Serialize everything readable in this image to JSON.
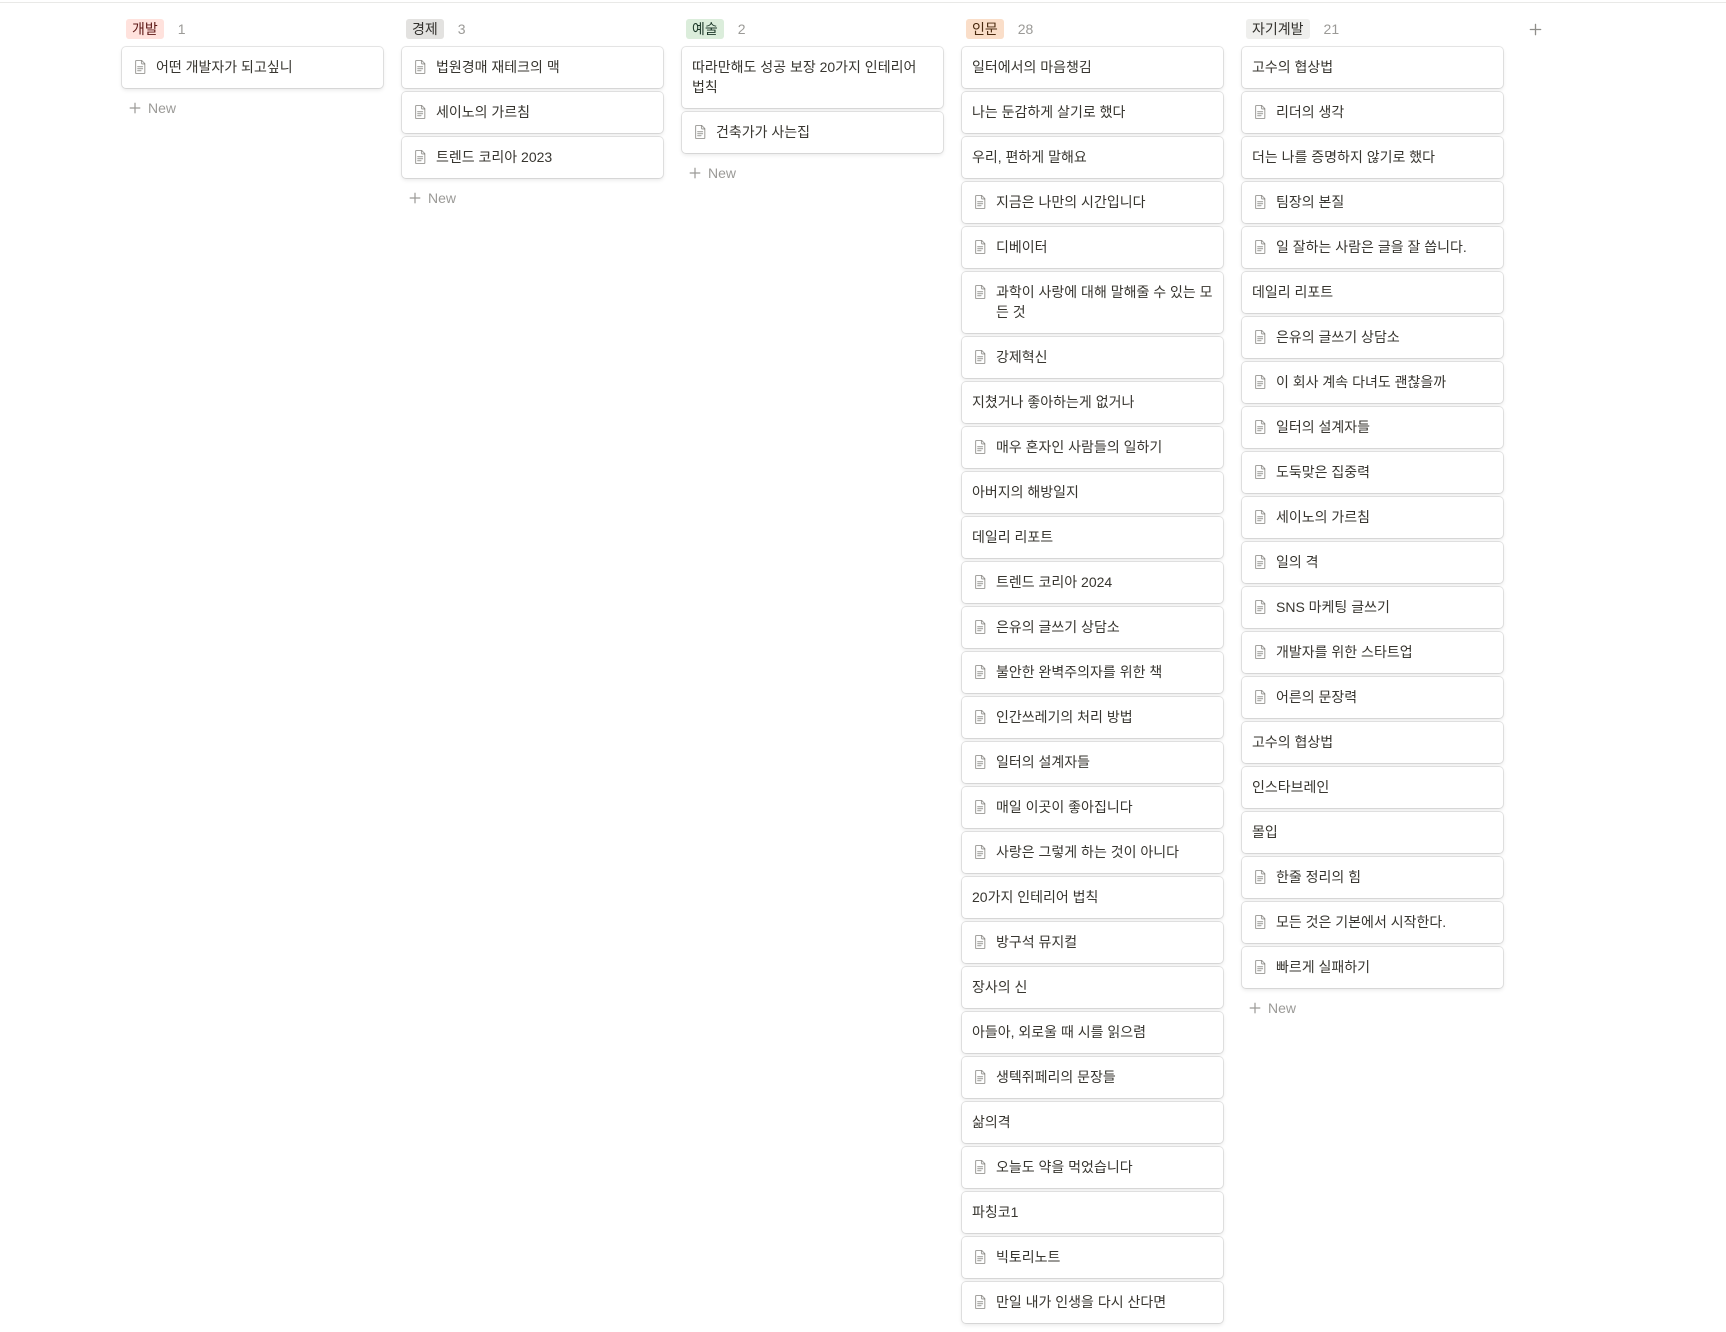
{
  "board": {
    "add_group_icon": "plus-icon",
    "new_label": "New",
    "new_icon": "plus-icon",
    "columns": [
      {
        "tag": "개발",
        "count": 1,
        "tag_bg": "#FFE2DD",
        "tag_fg": "#5D1715",
        "cards": [
          {
            "title": "어떤 개발자가 되고싶니",
            "icon": "page-icon"
          }
        ]
      },
      {
        "tag": "경제",
        "count": 3,
        "tag_bg": "#E3E2E0",
        "tag_fg": "#32302C",
        "cards": [
          {
            "title": "법원경매 재테크의 맥",
            "icon": "page-icon"
          },
          {
            "title": "세이노의 가르침",
            "icon": "page-icon"
          },
          {
            "title": "트렌드 코리아 2023",
            "icon": "page-icon"
          }
        ]
      },
      {
        "tag": "예술",
        "count": 2,
        "tag_bg": "#DBEDDB",
        "tag_fg": "#1C3829",
        "cards": [
          {
            "title": "따라만해도 성공 보장 20가지 인테리어 법칙",
            "icon": null
          },
          {
            "title": "건축가가 사는집",
            "icon": "page-icon"
          }
        ]
      },
      {
        "tag": "인문",
        "count": 28,
        "tag_bg": "#FADEC9",
        "tag_fg": "#49290E",
        "cards": [
          {
            "title": "일터에서의 마음챙김",
            "icon": null
          },
          {
            "title": "나는 둔감하게 살기로 했다",
            "icon": null
          },
          {
            "title": "우리, 편하게 말해요",
            "icon": null
          },
          {
            "title": "지금은 나만의 시간입니다",
            "icon": "page-icon"
          },
          {
            "title": "디베이터",
            "icon": "page-icon"
          },
          {
            "title": "과학이 사랑에 대해 말해줄 수 있는 모든 것",
            "icon": "page-icon"
          },
          {
            "title": "강제혁신",
            "icon": "page-icon"
          },
          {
            "title": "지쳤거나 좋아하는게 없거나",
            "icon": null
          },
          {
            "title": "매우 혼자인 사람들의 일하기",
            "icon": "page-icon"
          },
          {
            "title": "아버지의 해방일지",
            "icon": null
          },
          {
            "title": "데일리 리포트",
            "icon": null
          },
          {
            "title": "트렌드 코리아 2024",
            "icon": "page-icon"
          },
          {
            "title": "은유의 글쓰기 상담소",
            "icon": "page-icon"
          },
          {
            "title": "불안한 완벽주의자를 위한 책",
            "icon": "page-icon"
          },
          {
            "title": "인간쓰레기의 처리 방법",
            "icon": "page-icon"
          },
          {
            "title": "일터의 설계자들",
            "icon": "page-icon"
          },
          {
            "title": "매일 이곳이 좋아집니다",
            "icon": "page-icon"
          },
          {
            "title": "사랑은 그렇게 하는 것이 아니다",
            "icon": "page-icon"
          },
          {
            "title": "20가지 인테리어 법칙",
            "icon": null
          },
          {
            "title": "방구석 뮤지컬",
            "icon": "page-icon"
          },
          {
            "title": "장사의 신",
            "icon": null
          },
          {
            "title": "아들아, 외로울 때 시를 읽으렴",
            "icon": null
          },
          {
            "title": "생텍쥐페리의 문장들",
            "icon": "page-icon"
          },
          {
            "title": "삶의격",
            "icon": null
          },
          {
            "title": "오늘도 약을 먹었습니다",
            "icon": "page-icon"
          },
          {
            "title": "파칭코1",
            "icon": null
          },
          {
            "title": "빅토리노트",
            "icon": "page-icon"
          },
          {
            "title": "만일 내가 인생을 다시 산다면",
            "icon": "page-icon"
          }
        ]
      },
      {
        "tag": "자기계발",
        "count": 21,
        "tag_bg": "#EFEFED",
        "tag_fg": "#32302C",
        "cards": [
          {
            "title": "고수의 협상법",
            "icon": null
          },
          {
            "title": "리더의 생각",
            "icon": "page-icon"
          },
          {
            "title": "더는 나를 증명하지 않기로 했다",
            "icon": null
          },
          {
            "title": "팀장의 본질",
            "icon": "page-icon"
          },
          {
            "title": "일 잘하는 사람은 글을 잘 씁니다.",
            "icon": "page-icon"
          },
          {
            "title": "데일리 리포트",
            "icon": null
          },
          {
            "title": "은유의 글쓰기 상담소",
            "icon": "page-icon"
          },
          {
            "title": "이 회사 계속 다녀도 괜찮을까",
            "icon": "page-icon"
          },
          {
            "title": "일터의 설계자들",
            "icon": "page-icon"
          },
          {
            "title": "도둑맞은 집중력",
            "icon": "page-icon"
          },
          {
            "title": "세이노의 가르침",
            "icon": "page-icon"
          },
          {
            "title": "일의 격",
            "icon": "page-icon"
          },
          {
            "title": "SNS 마케팅 글쓰기",
            "icon": "page-icon"
          },
          {
            "title": "개발자를 위한 스타트업",
            "icon": "page-icon"
          },
          {
            "title": "어른의 문장력",
            "icon": "page-icon"
          },
          {
            "title": "고수의 협상법",
            "icon": null
          },
          {
            "title": "인스타브레인",
            "icon": null
          },
          {
            "title": "몰입",
            "icon": null
          },
          {
            "title": "한줄 정리의 힘",
            "icon": "page-icon"
          },
          {
            "title": "모든 것은 기본에서 시작한다.",
            "icon": "page-icon"
          },
          {
            "title": "빠르게 실패하기",
            "icon": "page-icon"
          }
        ]
      }
    ]
  }
}
